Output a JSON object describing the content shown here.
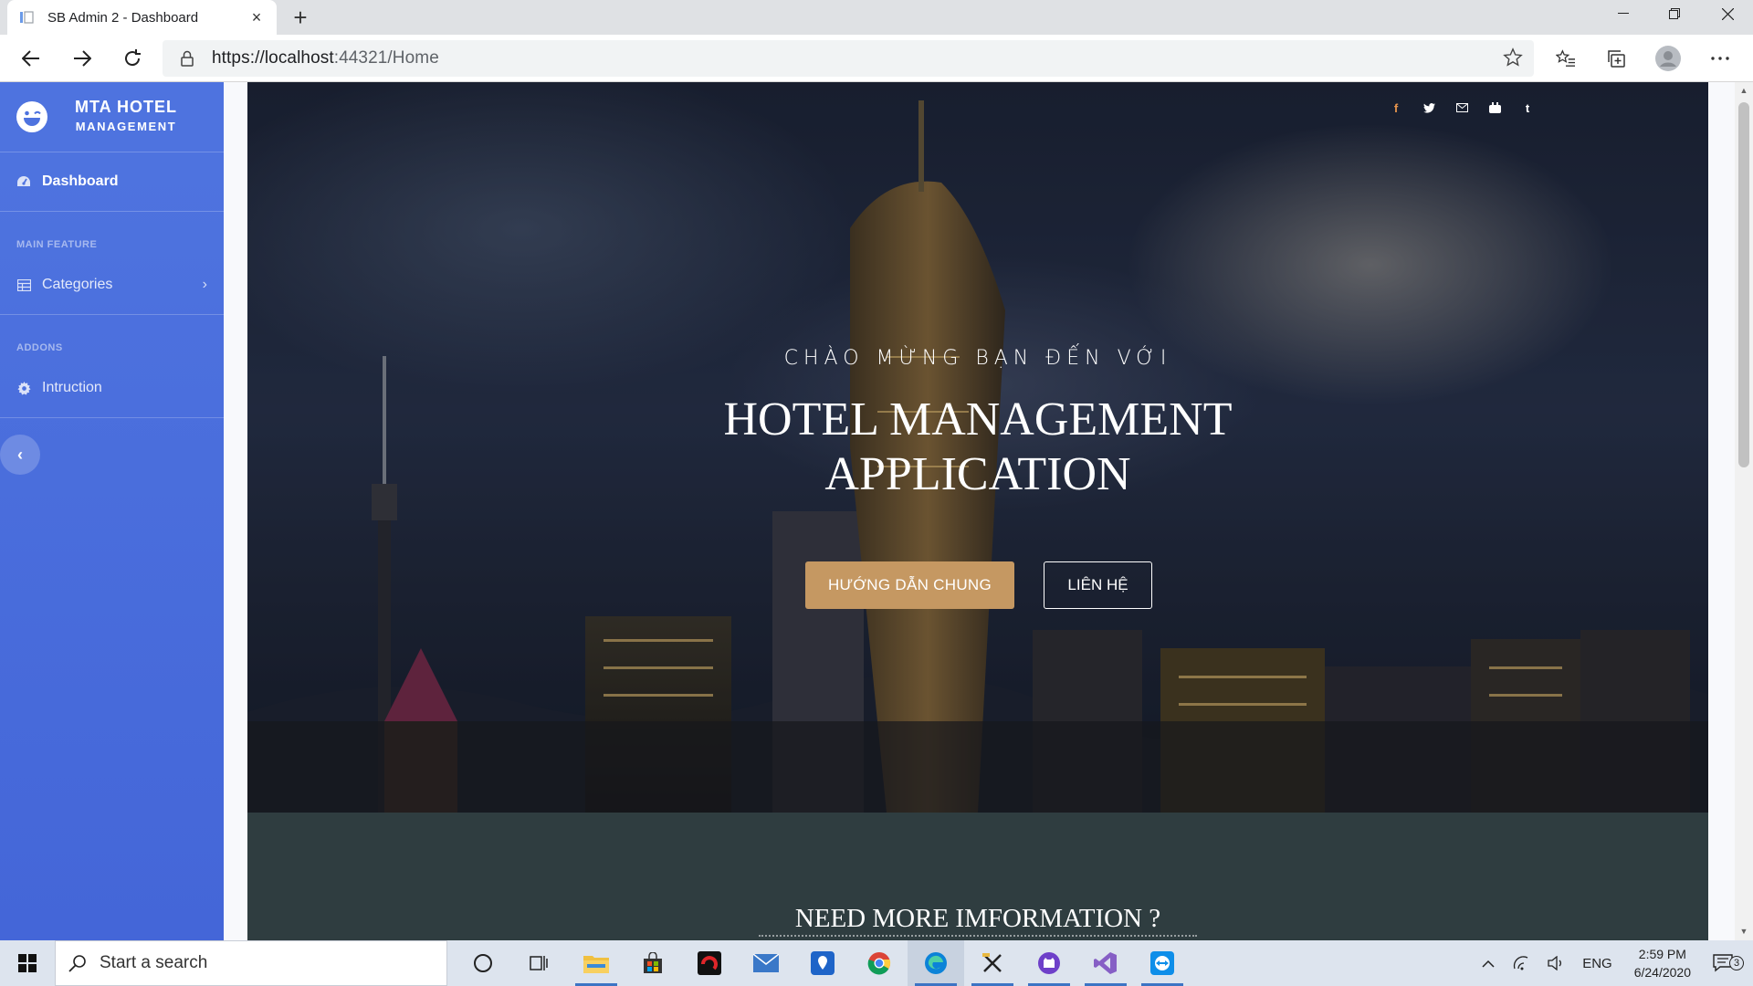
{
  "browser": {
    "tab_title": "SB Admin 2 - Dashboard",
    "url_prefix": "https://localhost",
    "url_rest": ":44321/Home"
  },
  "sidebar": {
    "brand_line1": "MTA HOTEL",
    "brand_line2": "MANAGEMENT",
    "items": [
      {
        "label": "Dashboard",
        "icon": "tachometer-icon"
      },
      {
        "label": "Categories",
        "icon": "table-icon"
      },
      {
        "label": "Intruction",
        "icon": "gear-icon"
      }
    ],
    "headings": [
      "MAIN FEATURE",
      "ADDONS"
    ]
  },
  "hero": {
    "welcome": "CHÀO MỪNG BẠN ĐẾN VỚI",
    "title_line1": "HOTEL MANAGEMENT",
    "title_line2": "APPLICATION",
    "primary_button": "HƯỚNG DẪN CHUNG",
    "secondary_button": "LIÊN HỆ",
    "social": [
      "f",
      "twitter-icon",
      "mail-icon",
      "youtube-icon",
      "t"
    ]
  },
  "info": {
    "title": "NEED MORE IMFORMATION ?"
  },
  "taskbar": {
    "search_placeholder": "Start a search",
    "language": "ENG",
    "time": "2:59 PM",
    "date": "6/24/2020",
    "notification_count": "3"
  },
  "colors": {
    "sidebar": "#4e73df",
    "primary_button": "#c59862"
  }
}
